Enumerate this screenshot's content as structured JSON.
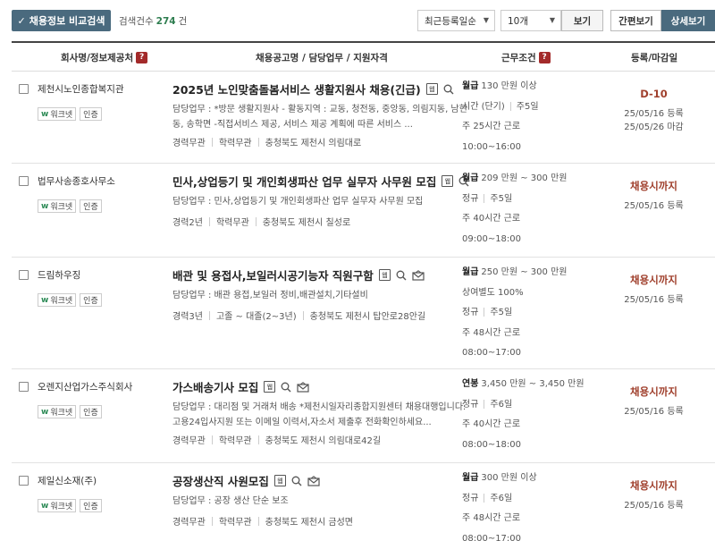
{
  "toolbar": {
    "compare_label": "채용정보 비교검색",
    "result_label": "검색건수",
    "result_count": "274",
    "result_unit": "건",
    "sort_value": "최근등록일순",
    "per_page_value": "10개",
    "view_label": "보기",
    "simple_view_label": "간편보기",
    "detail_view_label": "상세보기"
  },
  "header": {
    "company": "회사명/정보제공처",
    "title": "채용공고명 / 담당업무 / 지원자격",
    "conditions": "근무조건",
    "registration": "등록/마감일",
    "help_glyph": "?"
  },
  "badges": {
    "worknet": "워크넷",
    "certified": "인증",
    "doc_glyph": "웹"
  },
  "rows": [
    {
      "company": "제천시노인종합복지관",
      "title": "2025년 노인맞춤돌봄서비스 생활지원사 채용(긴급)",
      "has_mail": false,
      "duty": "담당업무 : *방문 생활지원사 - 활동지역 : 교동, 청전동, 중앙동, 의림지동, 남현동, 송학면 -직접서비스 제공, 서비스 제공 계획에 따른 서비스 ...",
      "meta": [
        "경력무관",
        "학력무관",
        "충청북도 제천시 의림대로"
      ],
      "pay_type": "월급",
      "pay": "130 만원 이상",
      "cond2a": "시간 (단기)",
      "cond2b": "주5일",
      "cond3": "주 25시간 근로",
      "cond4": "10:00~16:00",
      "deadline": "D-10",
      "registered": "25/05/16 등록",
      "closing": "25/05/26 마감"
    },
    {
      "company": "법무사송종호사무소",
      "title": "민사,상업등기 및 개인회생파산 업무 실무자 사무원 모집",
      "has_mail": false,
      "duty": "담당업무 : 민사,상업등기 및 개인회생파산 업무 실무자 사무원 모집",
      "meta": [
        "경력2년",
        "학력무관",
        "충청북도 제천시 칠성로"
      ],
      "pay_type": "월급",
      "pay": "209 만원 ~ 300 만원",
      "cond2a": "정규",
      "cond2b": "주5일",
      "cond3": "주 40시간 근로",
      "cond4": "09:00~18:00",
      "deadline": "채용시까지",
      "registered": "25/05/16 등록",
      "closing": ""
    },
    {
      "company": "드림하우징",
      "title": "배관 및 용접사,보일러시공기능자 직원구함",
      "has_mail": true,
      "duty": "담당업무 : 배관 용접,보일러 정비,배관설치,기타설비",
      "meta": [
        "경력3년",
        "고졸 ~ 대졸(2~3년)",
        "충청북도 제천시 탑안로28안길"
      ],
      "pay_type": "월급",
      "pay": "250 만원 ~ 300 만원",
      "cond1b": "상여별도 100%",
      "cond2a": "정규",
      "cond2b": "주5일",
      "cond3": "주 48시간 근로",
      "cond4": "08:00~17:00",
      "deadline": "채용시까지",
      "registered": "25/05/16 등록",
      "closing": ""
    },
    {
      "company": "오렌지산업가스주식회사",
      "title": "가스배송기사 모집",
      "has_mail": true,
      "duty": "담당업무 : 대리점 및 거래처 배송 *제천시일자리종합지원센터 채용대행입니다. 고용24입사지원 또는 이메일 이력서,자소서 제출후 전화확인하세요...",
      "meta": [
        "경력무관",
        "학력무관",
        "충청북도 제천시 의림대로42길"
      ],
      "pay_type": "연봉",
      "pay": "3,450 만원 ~ 3,450 만원",
      "cond2a": "정규",
      "cond2b": "주6일",
      "cond3": "주 40시간 근로",
      "cond4": "08:00~18:00",
      "deadline": "채용시까지",
      "registered": "25/05/16 등록",
      "closing": ""
    },
    {
      "company": "제일신소재(주)",
      "title": "공장생산직 사원모집",
      "has_mail": true,
      "duty": "담당업무 : 공장 생산 단순 보조",
      "meta": [
        "경력무관",
        "학력무관",
        "충청북도 제천시 금성면"
      ],
      "pay_type": "월급",
      "pay": "300 만원 이상",
      "cond2a": "정규",
      "cond2b": "주6일",
      "cond3": "주 48시간 근로",
      "cond4": "08:00~17:00",
      "deadline": "채용시까지",
      "registered": "25/05/16 등록",
      "closing": ""
    }
  ]
}
